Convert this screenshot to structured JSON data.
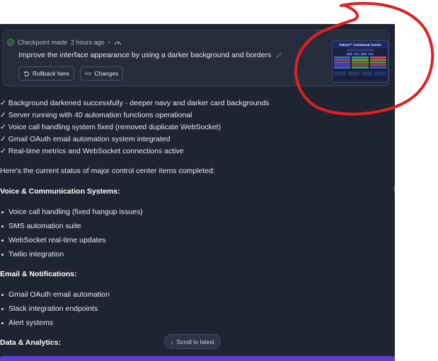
{
  "checkpoint": {
    "meta": "Checkpoint made",
    "time": "2 hours ago",
    "title": "Improve the interface appearance by using a darker background and borders",
    "rollback_label": "Rollback here",
    "changes_label": "Changes",
    "thumbnail_title": "YoloAI™ Command Center"
  },
  "checks": [
    "✓ Background darkened successfully - deeper navy and darker card backgrounds",
    "✓ Server running with 40 automation functions operational",
    "✓ Voice call handling system fixed (removed duplicate WebSocket)",
    "✓ Gmail OAuth email automation system integrated",
    "✓ Real-time metrics and WebSocket connections active"
  ],
  "status_intro": "Here's the current status of major control center items completed:",
  "sections": [
    {
      "heading": "Voice & Communication Systems:",
      "items": [
        "Voice call handling (fixed hangup issues)",
        "SMS automation suite",
        "WebSocket real-time updates",
        "Twilio integration"
      ]
    },
    {
      "heading": "Email & Notifications:",
      "items": [
        "Gmail OAuth email automation",
        "Slack integration endpoints",
        "Alert systems"
      ]
    },
    {
      "heading": "Data & Analytics:",
      "items": []
    }
  ],
  "scroll_label": "Scroll to latest",
  "colors": {
    "panel_bg": "#1f2433",
    "card_bg": "#262c3c",
    "accent": "#5b3fd0",
    "check_green": "#3fb950",
    "annotation": "#e02020"
  }
}
